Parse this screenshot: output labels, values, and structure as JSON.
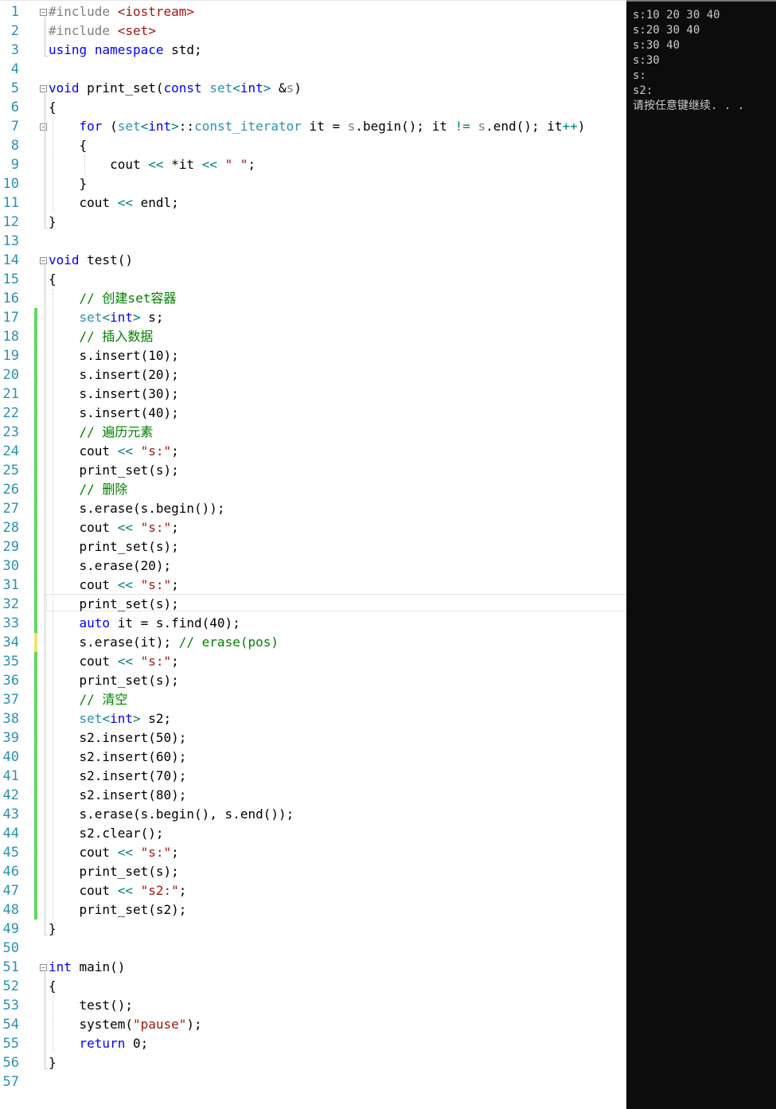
{
  "editor": {
    "language": "C++",
    "lines": [
      [
        [
          "pp",
          "#include "
        ],
        [
          "ppk",
          "<iostream>"
        ]
      ],
      [
        [
          "pp",
          "#include "
        ],
        [
          "ppk",
          "<set>"
        ]
      ],
      [
        [
          "kw",
          "using"
        ],
        [
          "",
          "",
          " "
        ],
        [
          "kw",
          "namespace"
        ],
        [
          "",
          " std;"
        ]
      ],
      [],
      [
        [
          "kw",
          "void"
        ],
        [
          "",
          " print_set("
        ],
        [
          "kw",
          "const"
        ],
        [
          "",
          " "
        ],
        [
          "ty",
          "set"
        ],
        [
          "op",
          "<"
        ],
        [
          "kw",
          "int"
        ],
        [
          "op",
          ">"
        ],
        [
          "",
          " &"
        ],
        [
          "pa",
          "s"
        ],
        [
          "",
          ")"
        ]
      ],
      [
        [
          "",
          "{"
        ]
      ],
      [
        [
          "",
          "    "
        ],
        [
          "kw",
          "for"
        ],
        [
          "",
          " ("
        ],
        [
          "ty",
          "set"
        ],
        [
          "op",
          "<"
        ],
        [
          "kw",
          "int"
        ],
        [
          "op",
          ">"
        ],
        [
          "",
          "::"
        ],
        [
          "ty",
          "const_iterator"
        ],
        [
          "",
          " it = "
        ],
        [
          "pa",
          "s"
        ],
        [
          "",
          ".begin(); it "
        ],
        [
          "op",
          "!="
        ],
        [
          "",
          " "
        ],
        [
          "pa",
          "s"
        ],
        [
          "",
          ".end(); it"
        ],
        [
          "op",
          "++"
        ],
        [
          "",
          ")"
        ]
      ],
      [
        [
          "",
          "    {"
        ]
      ],
      [
        [
          "",
          "        cout "
        ],
        [
          "op",
          "<<"
        ],
        [
          "",
          " *it "
        ],
        [
          "op",
          "<<"
        ],
        [
          "",
          " "
        ],
        [
          "str",
          "\" \""
        ],
        [
          "",
          ";"
        ]
      ],
      [
        [
          "",
          "    }"
        ]
      ],
      [
        [
          "",
          "    cout "
        ],
        [
          "op",
          "<<"
        ],
        [
          "",
          " endl;"
        ]
      ],
      [
        [
          "",
          "}"
        ]
      ],
      [],
      [
        [
          "kw",
          "void"
        ],
        [
          "",
          " test()"
        ]
      ],
      [
        [
          "",
          "{"
        ]
      ],
      [
        [
          "",
          "    "
        ],
        [
          "cm",
          "// 创建set容器"
        ]
      ],
      [
        [
          "",
          "    "
        ],
        [
          "ty",
          "set"
        ],
        [
          "op",
          "<"
        ],
        [
          "kw",
          "int"
        ],
        [
          "op",
          ">"
        ],
        [
          "",
          " s;"
        ]
      ],
      [
        [
          "",
          "    "
        ],
        [
          "cm",
          "// 插入数据"
        ]
      ],
      [
        [
          "",
          "    s.insert(10);"
        ]
      ],
      [
        [
          "",
          "    s.insert(20);"
        ]
      ],
      [
        [
          "",
          "    s.insert(30);"
        ]
      ],
      [
        [
          "",
          "    s.insert(40);"
        ]
      ],
      [
        [
          "",
          "    "
        ],
        [
          "cm",
          "// 遍历元素"
        ]
      ],
      [
        [
          "",
          "    cout "
        ],
        [
          "op",
          "<<"
        ],
        [
          "",
          " "
        ],
        [
          "str",
          "\"s:\""
        ],
        [
          "",
          ";"
        ]
      ],
      [
        [
          "",
          "    print_set(s);"
        ]
      ],
      [
        [
          "",
          "    "
        ],
        [
          "cm",
          "// 删除"
        ]
      ],
      [
        [
          "",
          "    s.erase(s.begin());"
        ]
      ],
      [
        [
          "",
          "    cout "
        ],
        [
          "op",
          "<<"
        ],
        [
          "",
          " "
        ],
        [
          "str",
          "\"s:\""
        ],
        [
          "",
          ";"
        ]
      ],
      [
        [
          "",
          "    print_set(s);"
        ]
      ],
      [
        [
          "",
          "    s.erase(20);"
        ]
      ],
      [
        [
          "",
          "    cout "
        ],
        [
          "op",
          "<<"
        ],
        [
          "",
          " "
        ],
        [
          "str",
          "\"s:\""
        ],
        [
          "",
          ";"
        ]
      ],
      [
        [
          "",
          "    print_set(s);"
        ]
      ],
      [
        [
          "",
          "    "
        ],
        [
          "kw",
          "auto"
        ],
        [
          "",
          " it = s.find(40);"
        ]
      ],
      [
        [
          "",
          "    s.erase(it); "
        ],
        [
          "cm",
          "// erase(pos)"
        ]
      ],
      [
        [
          "",
          "    cout "
        ],
        [
          "op",
          "<<"
        ],
        [
          "",
          " "
        ],
        [
          "str",
          "\"s:\""
        ],
        [
          "",
          ";"
        ]
      ],
      [
        [
          "",
          "    print_set(s);"
        ]
      ],
      [
        [
          "",
          "    "
        ],
        [
          "cm",
          "// 清空"
        ]
      ],
      [
        [
          "",
          "    "
        ],
        [
          "ty",
          "set"
        ],
        [
          "op",
          "<"
        ],
        [
          "kw",
          "int"
        ],
        [
          "op",
          ">"
        ],
        [
          "",
          " s2;"
        ]
      ],
      [
        [
          "",
          "    s2.insert(50);"
        ]
      ],
      [
        [
          "",
          "    s2.insert(60);"
        ]
      ],
      [
        [
          "",
          "    s2.insert(70);"
        ]
      ],
      [
        [
          "",
          "    s2.insert(80);"
        ]
      ],
      [
        [
          "",
          "    s.erase(s.begin(), s.end());"
        ]
      ],
      [
        [
          "",
          "    s2.clear();"
        ]
      ],
      [
        [
          "",
          "    cout "
        ],
        [
          "op",
          "<<"
        ],
        [
          "",
          " "
        ],
        [
          "str",
          "\"s:\""
        ],
        [
          "",
          ";"
        ]
      ],
      [
        [
          "",
          "    print_set(s);"
        ]
      ],
      [
        [
          "",
          "    cout "
        ],
        [
          "op",
          "<<"
        ],
        [
          "",
          " "
        ],
        [
          "str",
          "\"s2:\""
        ],
        [
          "",
          ";"
        ]
      ],
      [
        [
          "",
          "    print_set(s2);"
        ]
      ],
      [
        [
          "",
          "}"
        ]
      ],
      [],
      [
        [
          "kw",
          "int"
        ],
        [
          "",
          " main()"
        ]
      ],
      [
        [
          "",
          "{"
        ]
      ],
      [
        [
          "",
          "    test();"
        ]
      ],
      [
        [
          "",
          "    system("
        ],
        [
          "str",
          "\"pause\""
        ],
        [
          "",
          ");"
        ]
      ],
      [
        [
          "",
          "    "
        ],
        [
          "kw",
          "return"
        ],
        [
          "",
          " 0;"
        ]
      ],
      [
        [
          "",
          "}"
        ]
      ],
      []
    ],
    "current_line": 32,
    "fold_markers": [
      1,
      5,
      7,
      14,
      51
    ],
    "change_markers": {
      "saved_green": [
        [
          17,
          33
        ],
        [
          35,
          48
        ]
      ],
      "unsaved_yellow": [
        [
          34,
          34
        ]
      ]
    },
    "colors": {
      "line_number": "#2b91af",
      "keyword": "#0000ff",
      "type": "#2b91af",
      "string": "#a31515",
      "comment": "#008000",
      "change_saved": "#5fd75f",
      "change_unsaved": "#f0e36a"
    }
  },
  "console": {
    "lines": [
      "s:10 20 30 40",
      "s:20 30 40",
      "s:30 40",
      "s:30",
      "s:",
      "s2:",
      "请按任意键继续. . ."
    ],
    "background": "#0c0c0c",
    "foreground": "#cccccc"
  }
}
